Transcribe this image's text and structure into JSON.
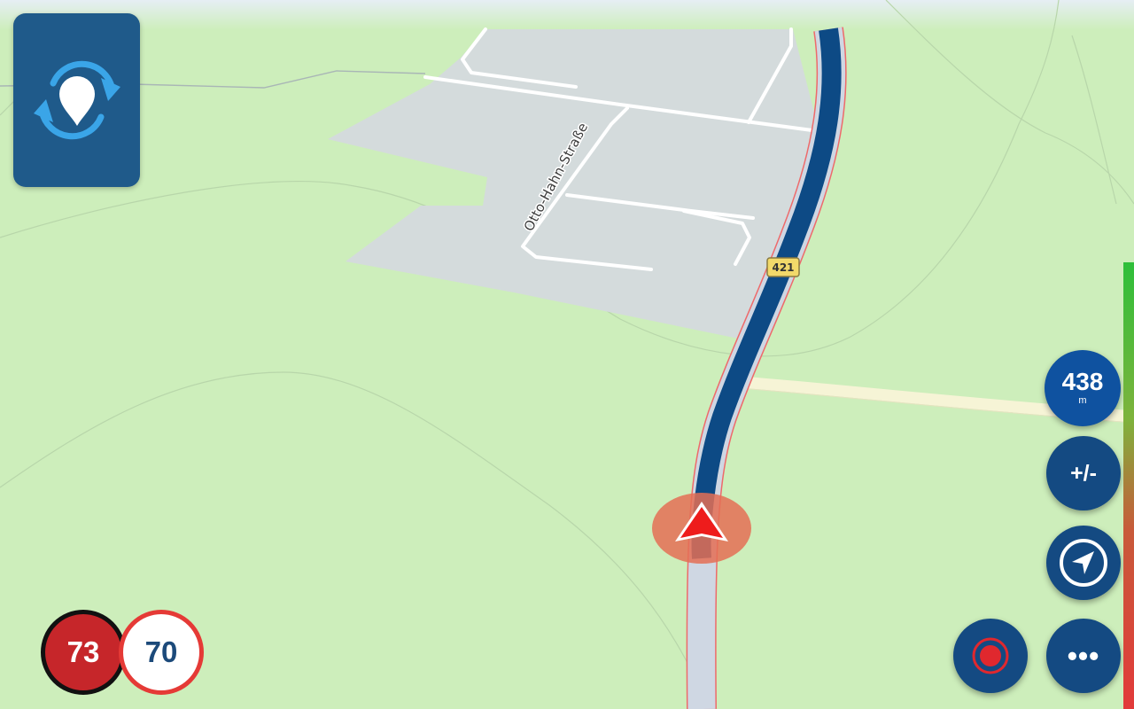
{
  "map": {
    "street_label": "Otto-Hahn-Straße",
    "road_shield": "421"
  },
  "app_button": {
    "icon": "location-refresh-icon"
  },
  "speed": {
    "current": "73",
    "limit": "70"
  },
  "controls": {
    "distance_value": "438",
    "distance_unit": "m",
    "zoom_label": "+/-",
    "navigate_icon": "navigation-arrow-icon",
    "more_label": "•••",
    "record_icon": "record-icon"
  },
  "colors": {
    "route": "#0d4a85",
    "accent_blue": "#144a82",
    "speed_current_bg": "#c6262a",
    "speed_limit_border": "#e53a36",
    "position_arrow": "#ee1c1c"
  }
}
